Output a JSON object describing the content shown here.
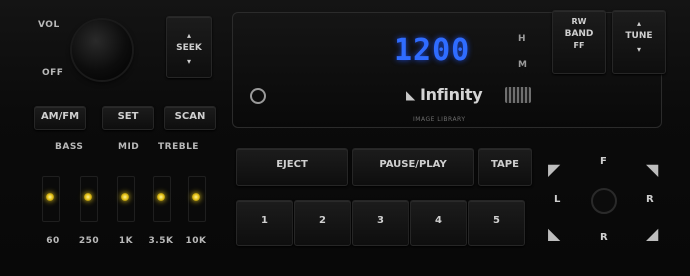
{
  "left_panel": {
    "vol_label": "VOL",
    "off_label": "OFF",
    "seek_label": "SEEK",
    "am_fm_label": "AM/FM",
    "set_label": "SET",
    "scan_label": "SCAN",
    "bass_label": "BASS",
    "mid_label": "MID",
    "treble_label": "TREBLE",
    "slider_labels": [
      "60",
      "250",
      "1K",
      "3.5K",
      "10K"
    ],
    "led_color": "#f2d41e"
  },
  "display": {
    "time": "1200",
    "indicator_top": "H",
    "indicator_bottom": "M",
    "brand": "Infinity",
    "subtitle": "IMAGE LIBRARY",
    "digit_color": "#2f6cff"
  },
  "right_panel": {
    "rw_label": "RW",
    "band_label": "BAND",
    "ff_label": "FF",
    "tune_label": "TUNE"
  },
  "bottom_panel": {
    "eject_label": "EJECT",
    "pause_play_label": "PAUSE/PLAY",
    "tape_label": "TAPE",
    "presets": [
      "1",
      "2",
      "3",
      "4",
      "5"
    ]
  },
  "dpad": {
    "top": "F",
    "left": "L",
    "right": "R",
    "bottom": "R"
  }
}
